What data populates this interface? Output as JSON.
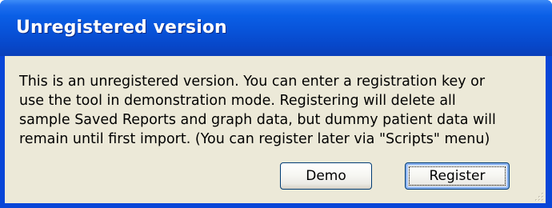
{
  "window": {
    "title": "Unregistered version"
  },
  "dialog": {
    "message": "This is an unregistered version.  You can enter a registration key or\nuse the tool in demonstration mode.  Registering will delete all\nsample Saved Reports and graph data, but dummy patient data will\nremain until first import.  (You can register later via \"Scripts\" menu)",
    "demo_label": "Demo",
    "register_label": "Register",
    "default_button": "Register"
  },
  "colors": {
    "titlebar": "#0a5fe6",
    "window_frame": "#0846d8",
    "client_background": "#ece9d8",
    "button_border": "#003c74"
  },
  "icons": {
    "resize_grip": "resize-grip-icon"
  }
}
